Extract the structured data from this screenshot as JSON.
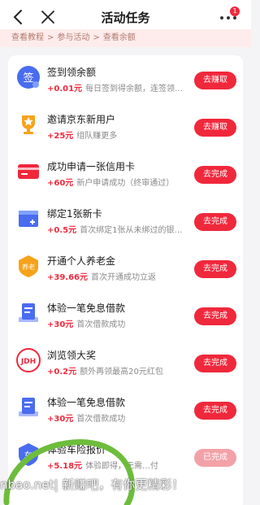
{
  "header": {
    "title": "活动任务",
    "badge_count": "1"
  },
  "breadcrumb": {
    "items": [
      "查看教程",
      "参与活动",
      "查看余额"
    ],
    "separator": ">"
  },
  "tasks": [
    {
      "icon": "sign-in-icon",
      "icon_text": "签",
      "name": "签到领余额",
      "reward": "+0.01元",
      "desc": "每日签到得余额，连签领…",
      "button": "去赚取",
      "state": "active"
    },
    {
      "icon": "trophy-icon",
      "icon_text": "",
      "name": "邀请京东新用户",
      "reward": "+25元",
      "desc": "组队赚更多",
      "button": "去赚取",
      "state": "active"
    },
    {
      "icon": "credit-card-icon",
      "icon_text": "",
      "name": "成功申请一张信用卡",
      "reward": "+60元",
      "desc": "新户申请成功（终审通过）",
      "button": "去完成",
      "state": "active"
    },
    {
      "icon": "add-card-icon",
      "icon_text": "+",
      "name": "绑定1张新卡",
      "reward": "+0.5元",
      "desc": "首次绑定1张从未绑过的银…",
      "button": "去完成",
      "state": "active"
    },
    {
      "icon": "pension-icon",
      "icon_text": "养老",
      "name": "开通个人养老金",
      "reward": "+39.66元",
      "desc": "首次开通成功立返",
      "button": "去完成",
      "state": "active"
    },
    {
      "icon": "document-icon",
      "icon_text": "",
      "name": "体验一笔免息借款",
      "reward": "+30元",
      "desc": "首次借款成功",
      "button": "去完成",
      "state": "active"
    },
    {
      "icon": "jdh-icon",
      "icon_text": "JDH",
      "name": "浏览领大奖",
      "reward": "+0.2元",
      "desc": "额外再领最高20元红包",
      "button": "去完成",
      "state": "active"
    },
    {
      "icon": "document-icon",
      "icon_text": "",
      "name": "体验一笔免息借款",
      "reward": "+30元",
      "desc": "首次借款成功",
      "button": "去完成",
      "state": "active"
    },
    {
      "icon": "car-insurance-icon",
      "icon_text": "车",
      "name": "体验车险报价",
      "reward": "+5.18元",
      "desc": "体验即得，无需…付",
      "button": "已完成",
      "state": "done"
    }
  ],
  "watermark": "nbao.net| 新赚吧，有你更精彩！",
  "colors": {
    "accent": "#f0283c",
    "done": "#f3a1a8",
    "breadcrumb_bg": "#fdeceb",
    "circle_mark": "#6dbd3c"
  }
}
